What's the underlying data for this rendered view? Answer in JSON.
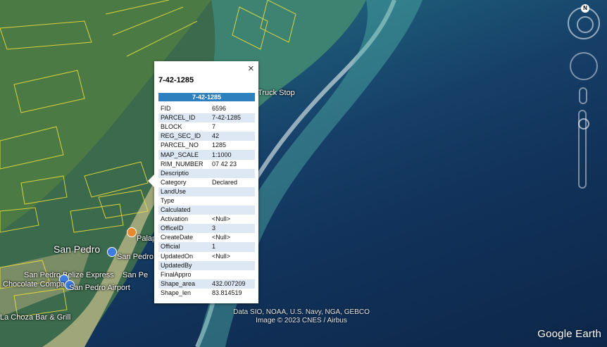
{
  "map": {
    "labels": {
      "truck_stop": "Truck Stop",
      "san_pedro": "San Pedro",
      "san_pedro_poi": "San Pedro",
      "palapa": "Palap",
      "belize_express": "San Pedro Belize Express",
      "san_pe_2": "San Pe",
      "chocolate": "Chocolate Compass",
      "airport": "San Pedro Airport",
      "la_choza": "La Choza Bar & Grill"
    },
    "attribution_line1": "Data SIO, NOAA, U.S. Navy, NGA, GEBCO",
    "attribution_line2": "Image © 2023 CNES / Airbus",
    "logo": "Google Earth"
  },
  "nav": {
    "compass_letter": "N"
  },
  "popup": {
    "title": "7-42-1285",
    "close": "×",
    "header": "7-42-1285",
    "attributes": [
      {
        "key": "FID",
        "value": "6596"
      },
      {
        "key": "PARCEL_ID",
        "value": "7-42-1285"
      },
      {
        "key": "BLOCK",
        "value": "7"
      },
      {
        "key": "REG_SEC_ID",
        "value": "42"
      },
      {
        "key": "PARCEL_NO",
        "value": "1285"
      },
      {
        "key": "MAP_SCALE",
        "value": "1:1000"
      },
      {
        "key": "RIM_NUMBER",
        "value": "07 42 23"
      },
      {
        "key": "Descriptio",
        "value": ""
      },
      {
        "key": "Category",
        "value": "Declared"
      },
      {
        "key": "LandUse",
        "value": ""
      },
      {
        "key": "Type",
        "value": ""
      },
      {
        "key": "Calculated",
        "value": ""
      },
      {
        "key": "Activation",
        "value": "<Null>"
      },
      {
        "key": "OfficeID",
        "value": "3"
      },
      {
        "key": "CreateDate",
        "value": "<Null>"
      },
      {
        "key": "Official",
        "value": "1"
      },
      {
        "key": "UpdatedOn",
        "value": "<Null>"
      },
      {
        "key": "UpdatedBy",
        "value": ""
      },
      {
        "key": "FinalAppro",
        "value": ""
      },
      {
        "key": "Shape_area",
        "value": "432.007209"
      },
      {
        "key": "Shape_len",
        "value": "83.814519"
      }
    ]
  }
}
